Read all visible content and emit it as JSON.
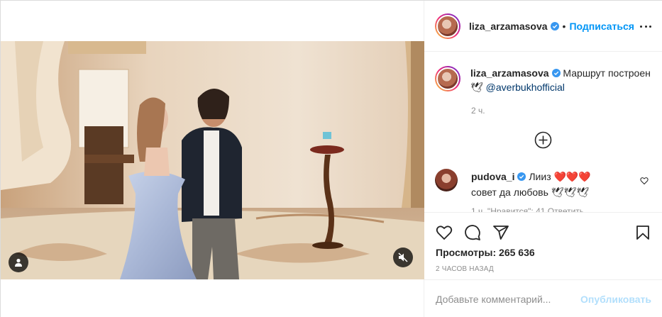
{
  "header": {
    "username": "liza_arzamasova",
    "separator": "•",
    "follow_label": "Подписаться",
    "more_icon": "more-horizontal-icon"
  },
  "caption": {
    "username": "liza_arzamasova",
    "text": "Маршрут построен 🕊",
    "mention": "@averbukhofficial",
    "time": "2 ч."
  },
  "load_more_icon": "plus-circle-icon",
  "comment": {
    "username": "pudova_i",
    "line1": "Лииз ❤️❤️❤️",
    "line2": "совет да любовь 🕊🕊🕊",
    "meta": "1 ч.   \"Нравится\": 41   Ответить"
  },
  "actions": {
    "like_icon": "heart-icon",
    "comment_icon": "comment-icon",
    "share_icon": "send-icon",
    "save_icon": "bookmark-icon",
    "views": "Просмотры: 265 636",
    "posted_ago": "2 ЧАСОВ НАЗАД"
  },
  "add_comment": {
    "placeholder": "Добавьте комментарий...",
    "publish_label": "Опубликовать"
  },
  "media": {
    "user_tag_icon": "user-icon",
    "mute_icon": "speaker-muted-icon"
  },
  "colors": {
    "link_blue": "#0095f6",
    "publish_disabled": "#b2dffc",
    "verified_blue": "#3897f0",
    "muted_text": "#8e8e8e"
  }
}
